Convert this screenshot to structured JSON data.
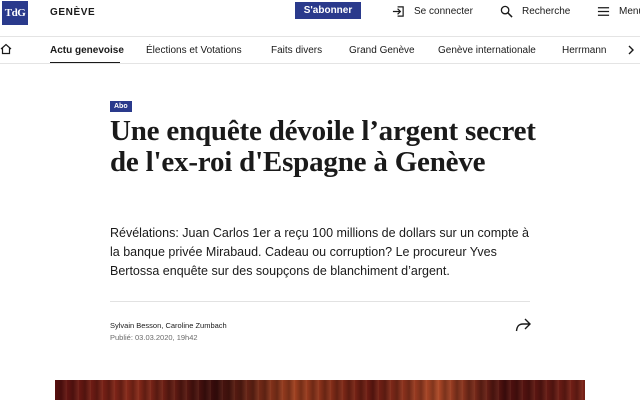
{
  "header": {
    "logo_text": "TdG",
    "section": "GENÈVE",
    "subscribe_label": "S'abonner",
    "login_label": "Se connecter",
    "search_label": "Recherche",
    "menu_label": "Menu",
    "brand_color": "#2a3a8c"
  },
  "nav": {
    "items": [
      {
        "label": "Actu genevoise",
        "active": true
      },
      {
        "label": "Élections et Votations",
        "active": false
      },
      {
        "label": "Faits divers",
        "active": false
      },
      {
        "label": "Grand Genève",
        "active": false
      },
      {
        "label": "Genève internationale",
        "active": false
      },
      {
        "label": "Herrmann",
        "active": false
      }
    ]
  },
  "article": {
    "badge": "Abo",
    "headline": "Une enquête dévoile l’argent secret de l'ex-roi d'Espagne à Genève",
    "lede": "Révélations: Juan Carlos 1er a reçu 100 millions de dollars sur un compte à la banque privée Mirabaud. Cadeau ou corruption? Le procureur Yves Bertossa enquête sur des soupçons de blanchiment d’argent.",
    "authors": "Sylvain Besson, Caroline Zumbach",
    "published": "Publié: 03.03.2020, 19h42"
  }
}
